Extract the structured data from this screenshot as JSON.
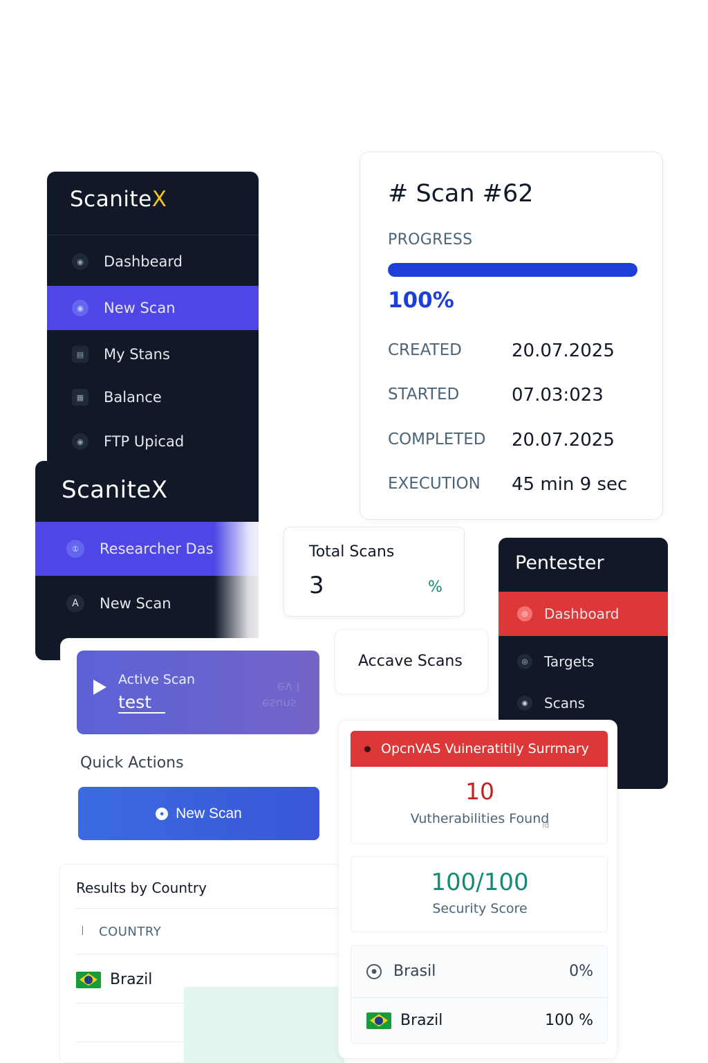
{
  "sidebar1": {
    "brand": "Scanite",
    "brand_x": "X",
    "items": [
      {
        "label": "Dashbeard",
        "icon": "dashboard-icon"
      },
      {
        "label": "New Scan",
        "icon": "new-scan-icon",
        "active": true
      },
      {
        "label": "My Stans",
        "icon": "my-scans-icon"
      },
      {
        "label": "Balance",
        "icon": "balance-icon"
      },
      {
        "label": "FTP Upicad",
        "icon": "ftp-upload-icon"
      }
    ]
  },
  "sidebar2": {
    "brand": "ScaniteX",
    "items": [
      {
        "label": "Researcher Das",
        "icon": "researcher-icon",
        "active": true
      },
      {
        "label": "New Scan",
        "icon": "new-scan-icon"
      }
    ]
  },
  "scan": {
    "title": "# Scan #62",
    "progress_label": "PROGRESS",
    "progress_value": 100,
    "progress_text": "100%",
    "created_label": "CREATED",
    "created_value": "20.07.2025",
    "started_label": "STARTED",
    "started_value": "07.03:023",
    "completed_label": "COMPLETED",
    "completed_value": "20.07.2025",
    "execution_label": "EXECUTION",
    "execution_value": "45 min 9 sec"
  },
  "total_scans": {
    "label": "Total Scans",
    "value": "3",
    "unit": "%"
  },
  "pentester": {
    "title": "Pentester",
    "items": [
      {
        "label": "Dashboard",
        "icon": "dashboard-icon",
        "active": true
      },
      {
        "label": "Targets",
        "icon": "targets-icon"
      },
      {
        "label": "Scans",
        "icon": "scans-icon"
      }
    ]
  },
  "active_scan": {
    "label": "Active Scan",
    "name": "test",
    "ghost_text_1": "ev l",
    "ghost_text_2": "esuns"
  },
  "accave_scans": {
    "label": "Accave Scans"
  },
  "quick_actions": {
    "title": "Quick Actions",
    "new_scan_label": "New Scan"
  },
  "results_by_country": {
    "title": "Results by Country",
    "column_header": "COUNTRY",
    "rows": [
      {
        "country": "Brazil"
      }
    ]
  },
  "openvas": {
    "title": "OpcnVAS Vuineratitily Surrmary",
    "vuln_count": "10",
    "vuln_label": "Vutherabilities Found",
    "vuln_suffix": "ıd",
    "score": "100/100",
    "score_label": "Security Score",
    "countries": [
      {
        "name": "Brasil",
        "pct": "0%"
      },
      {
        "name": "Brazil",
        "pct": "100 %"
      }
    ]
  },
  "colors": {
    "sidebar_bg": "#111827",
    "accent_purple": "#4f46e5",
    "accent_blue": "#1d3fd8",
    "danger_red": "#dc3838",
    "score_green": "#138a73",
    "brand_yellow": "#f5c518"
  }
}
